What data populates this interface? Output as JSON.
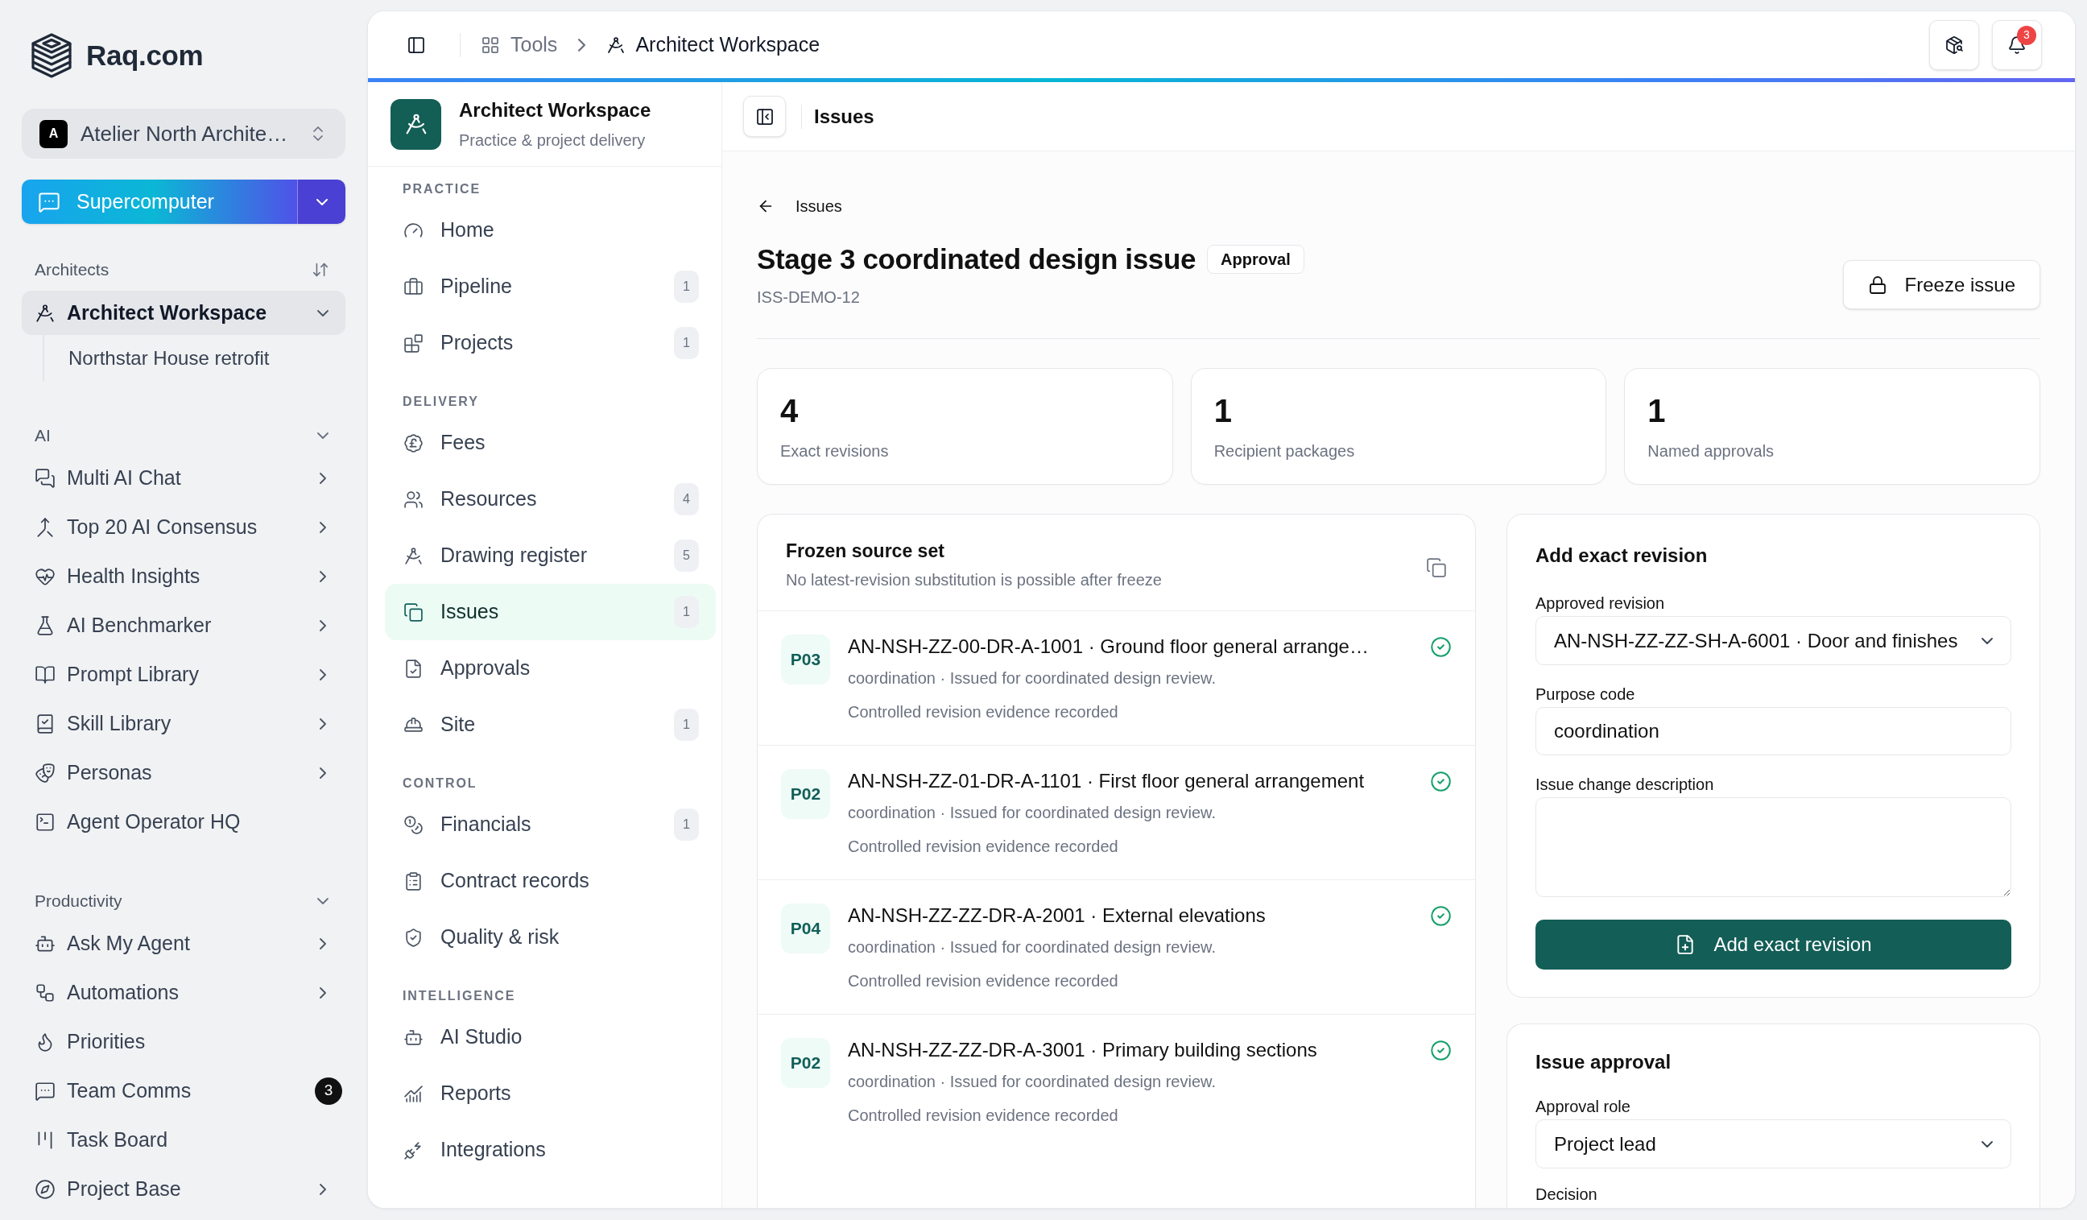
{
  "sidebar": {
    "brand": "Raq.com",
    "workspace_switcher": {
      "initial": "A",
      "name": "Atelier North Archite…"
    },
    "primary_action": {
      "label": "Supercomputer"
    },
    "sections": [
      {
        "title": "Architects",
        "kind": "sortable",
        "items": [
          {
            "label": "Architect Workspace",
            "selected": true,
            "expanded": true,
            "children": [
              {
                "label": "Northstar House retrofit",
                "selected": false
              }
            ]
          }
        ]
      },
      {
        "title": "AI",
        "kind": "collapsible",
        "expanded": true,
        "items": [
          {
            "label": "Multi AI Chat",
            "selected": false,
            "submenu": true
          },
          {
            "label": "Top 20 AI Consensus",
            "selected": false,
            "submenu": true
          },
          {
            "label": "Health Insights",
            "selected": false,
            "submenu": true
          },
          {
            "label": "AI Benchmarker",
            "selected": false,
            "submenu": true
          },
          {
            "label": "Prompt Library",
            "selected": false,
            "submenu": true
          },
          {
            "label": "Skill Library",
            "selected": false,
            "submenu": true
          },
          {
            "label": "Personas",
            "selected": false,
            "submenu": true
          },
          {
            "label": "Agent Operator HQ",
            "selected": false,
            "submenu": false
          }
        ]
      },
      {
        "title": "Productivity",
        "kind": "collapsible",
        "expanded": true,
        "items": [
          {
            "label": "Ask My Agent",
            "selected": false,
            "submenu": true
          },
          {
            "label": "Automations",
            "selected": false,
            "submenu": true
          },
          {
            "label": "Priorities",
            "selected": false,
            "submenu": false
          },
          {
            "label": "Team Comms",
            "selected": false,
            "submenu": false,
            "badge": "3"
          },
          {
            "label": "Task Board",
            "selected": false,
            "submenu": false
          },
          {
            "label": "Project Base",
            "selected": false,
            "submenu": true
          }
        ]
      }
    ]
  },
  "top_bar": {
    "breadcrumb": [
      {
        "label": "Tools"
      },
      {
        "label": "Architect Workspace"
      }
    ],
    "notifications": "3"
  },
  "workspace_nav": {
    "title": "Architect Workspace",
    "subtitle": "Practice & project delivery",
    "sections": [
      {
        "title": "PRACTICE",
        "items": [
          {
            "label": "Home",
            "selected": false
          },
          {
            "label": "Pipeline",
            "count": "1",
            "selected": false
          },
          {
            "label": "Projects",
            "count": "1",
            "selected": false
          }
        ]
      },
      {
        "title": "DELIVERY",
        "items": [
          {
            "label": "Fees",
            "selected": false
          },
          {
            "label": "Resources",
            "count": "4",
            "selected": false
          },
          {
            "label": "Drawing register",
            "count": "5",
            "selected": false
          },
          {
            "label": "Issues",
            "count": "1",
            "selected": true
          },
          {
            "label": "Approvals",
            "selected": false
          },
          {
            "label": "Site",
            "count": "1",
            "selected": false
          }
        ]
      },
      {
        "title": "CONTROL",
        "items": [
          {
            "label": "Financials",
            "count": "1",
            "selected": false
          },
          {
            "label": "Contract records",
            "selected": false
          },
          {
            "label": "Quality & risk",
            "selected": false
          }
        ]
      },
      {
        "title": "INTELLIGENCE",
        "items": [
          {
            "label": "AI Studio",
            "selected": false
          },
          {
            "label": "Reports",
            "selected": false
          },
          {
            "label": "Integrations",
            "selected": false
          }
        ]
      }
    ]
  },
  "page_header": {
    "title": "Issues"
  },
  "issue": {
    "back_label": "Issues",
    "title": "Stage 3 coordinated design issue",
    "status": "Approval",
    "reference": "ISS-DEMO-12",
    "action": "Freeze issue"
  },
  "stats": [
    {
      "value": "4",
      "label": "Exact revisions"
    },
    {
      "value": "1",
      "label": "Recipient packages"
    },
    {
      "value": "1",
      "label": "Named approvals"
    }
  ],
  "frozen_source_set": {
    "title": "Frozen source set",
    "subtitle": "No latest-revision substitution is possible after freeze",
    "rows": [
      {
        "revision": "P03",
        "title": "AN-NSH-ZZ-00-DR-A-1001 · Ground floor general arrange…",
        "meta": "coordination · Issued for coordinated design review.",
        "note": "Controlled revision evidence recorded",
        "verified": true
      },
      {
        "revision": "P02",
        "title": "AN-NSH-ZZ-01-DR-A-1101 · First floor general arrangement",
        "meta": "coordination · Issued for coordinated design review.",
        "note": "Controlled revision evidence recorded",
        "verified": true
      },
      {
        "revision": "P04",
        "title": "AN-NSH-ZZ-ZZ-DR-A-2001 · External elevations",
        "meta": "coordination · Issued for coordinated design review.",
        "note": "Controlled revision evidence recorded",
        "verified": true
      },
      {
        "revision": "P02",
        "title": "AN-NSH-ZZ-ZZ-DR-A-3001 · Primary building sections",
        "meta": "coordination · Issued for coordinated design review.",
        "note": "Controlled revision evidence recorded",
        "verified": true
      }
    ]
  },
  "add_revision": {
    "title": "Add exact revision",
    "fields": [
      {
        "kind": "select",
        "label": "Approved revision",
        "value": "AN-NSH-ZZ-ZZ-SH-A-6001 · Door and finishes"
      },
      {
        "kind": "text",
        "label": "Purpose code",
        "value": "coordination"
      },
      {
        "kind": "textarea",
        "label": "Issue change description"
      }
    ],
    "submit": "Add exact revision"
  },
  "issue_approval": {
    "title": "Issue approval",
    "fields": [
      {
        "kind": "select",
        "label": "Approval role",
        "value": "Project lead"
      },
      {
        "kind": "label",
        "label": "Decision"
      }
    ]
  }
}
